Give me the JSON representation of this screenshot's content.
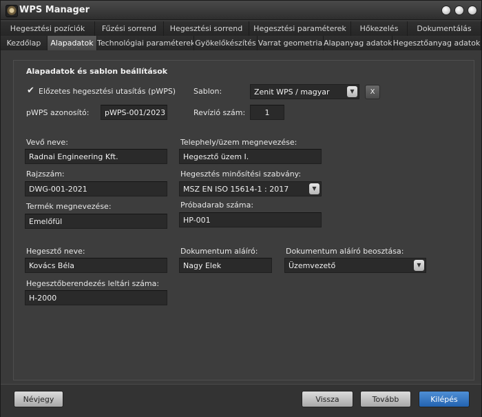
{
  "window": {
    "title": "WPS Manager"
  },
  "tabs_row1": [
    "Hegesztési pozíciók",
    "Fűzési sorrend",
    "Hegesztési sorrend",
    "Hegesztési paraméterek",
    "Hőkezelés",
    "Dokumentálás"
  ],
  "tabs_row2": [
    "Kezdőlap",
    "Alapadatok",
    "Technológiai paraméterek",
    "Gyökelőkészítés",
    "Varrat geometria",
    "Alapanyag adatok",
    "Hegesztőanyag adatok"
  ],
  "active_tab": "Alapadatok",
  "section_title": "Alapadatok és sablon beállítások",
  "form": {
    "pwps_check_label": "Előzetes hegesztési utasítás (pWPS)",
    "pwps_checked": true,
    "sablon_label": "Sablon:",
    "sablon_value": "Zenit WPS / magyar",
    "sablon_clear": "X",
    "pwps_id_label": "pWPS azonosító:",
    "pwps_id_value": "pWPS-001/2023",
    "revizio_label": "Revízió szám:",
    "revizio_value": "1",
    "vevo_label": "Vevő neve:",
    "vevo_value": "Radnai Engineering Kft.",
    "telephely_label": "Telephely/üzem megnevezése:",
    "telephely_value": "Hegesztő üzem I.",
    "rajzszam_label": "Rajzszám:",
    "rajzszam_value": "DWG-001-2021",
    "szabvany_label": "Hegesztés minősítési szabvány:",
    "szabvany_value": "MSZ EN ISO 15614-1 : 2017",
    "termek_label": "Termék megnevezése:",
    "termek_value": "Emelőfül",
    "probadarab_label": "Próbadarab száma:",
    "probadarab_value": "HP-001",
    "hegeszto_label": "Hegesztő neve:",
    "hegeszto_value": "Kovács Béla",
    "alairo_label": "Dokumentum aláíró:",
    "alairo_value": "Nagy Elek",
    "beosztas_label": "Dokumentum aláíró beosztása:",
    "beosztas_value": "Üzemvezető",
    "berendezes_label": "Hegesztőberendezés leltári száma:",
    "berendezes_value": "H-2000"
  },
  "buttons": {
    "about": "Névjegy",
    "back": "Vissza",
    "next": "Tovább",
    "exit": "Kilépés"
  }
}
